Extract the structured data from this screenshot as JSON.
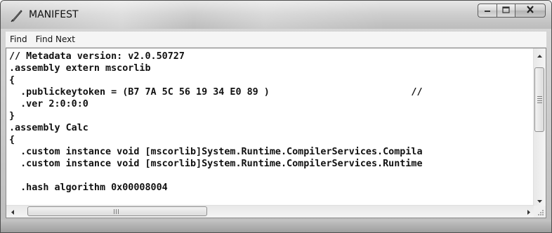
{
  "window": {
    "title": "MANIFEST",
    "icons": {
      "app": "quill-pen-icon",
      "minimize": "minimize-icon",
      "maximize": "maximize-icon",
      "close": "close-icon"
    }
  },
  "menu": {
    "items": [
      "Find",
      "Find Next"
    ]
  },
  "editor": {
    "lines": [
      "// Metadata version: v2.0.50727",
      ".assembly extern mscorlib",
      "{",
      "  .publickeytoken = (B7 7A 5C 56 19 34 E0 89 )                         //",
      "  .ver 2:0:0:0",
      "}",
      ".assembly Calc",
      "{",
      "  .custom instance void [mscorlib]System.Runtime.CompilerServices.Compila",
      "  .custom instance void [mscorlib]System.Runtime.CompilerServices.Runtime",
      "",
      "  .hash algorithm 0x00008004"
    ],
    "vertical_scroll_fraction": 0.0,
    "horizontal_scroll_fraction": 0.0
  },
  "scrollbars": {
    "up_icon": "arrow-up-icon",
    "down_icon": "arrow-down-icon",
    "left_icon": "arrow-left-icon",
    "right_icon": "arrow-right-icon",
    "thumb_grip_icon": "grip-icon"
  }
}
